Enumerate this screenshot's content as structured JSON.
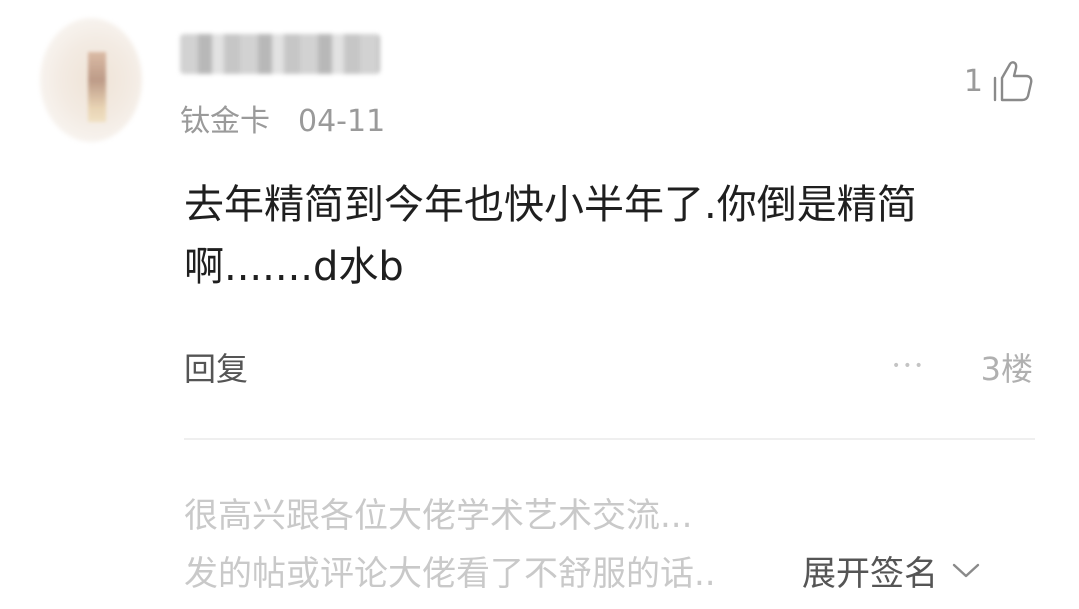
{
  "comment": {
    "badge": "钛金卡",
    "date": "04-11",
    "like_count": "1",
    "text_line1": "去年精简到今年也快小半年了.你倒是精简",
    "text_line2": "啊.......d水b",
    "reply_label": "回复",
    "more_label": "•••",
    "floor_label": "3楼"
  },
  "signature": {
    "line1": "很高兴跟各位大佬学术艺术交流...",
    "line2": "发的帖或评论大佬看了不舒服的话..",
    "expand_label": "展开签名"
  },
  "icons": {
    "like": "thumbs-up-icon",
    "expand": "chevron-down-icon"
  }
}
